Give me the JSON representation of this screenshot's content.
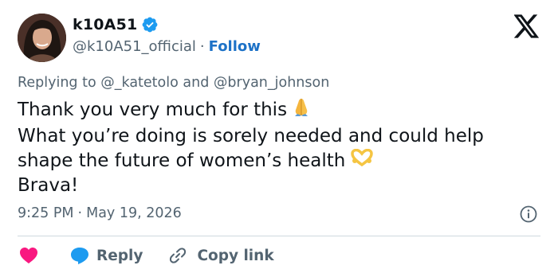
{
  "author": {
    "display_name": "k10A51",
    "handle": "@k10A51_official",
    "separator": "·",
    "follow_label": "Follow",
    "verified": true
  },
  "reply_context": {
    "prefix": "Replying to",
    "mention_1": "@_katetolo",
    "conjunction": "and",
    "mention_2": "@bryan_johnson"
  },
  "tweet": {
    "lines": [
      "Thank you very much for this",
      "What you’re doing is sorely needed and could help",
      "shape the future of women’s health",
      "Brava!"
    ],
    "emojis": [
      "folded-hands-emoji",
      "heart-hands-emoji"
    ]
  },
  "meta": {
    "time": "9:25 PM",
    "separator": "·",
    "date": "May 19, 2026"
  },
  "actions": {
    "reply_label": "Reply",
    "copy_link_label": "Copy link"
  },
  "colors": {
    "link_blue": "#1d72c7",
    "verified_blue": "#1d9bf0",
    "like_pink": "#f91880",
    "muted_text": "#536471",
    "text": "#0f1419",
    "divider": "#cfd9de"
  }
}
